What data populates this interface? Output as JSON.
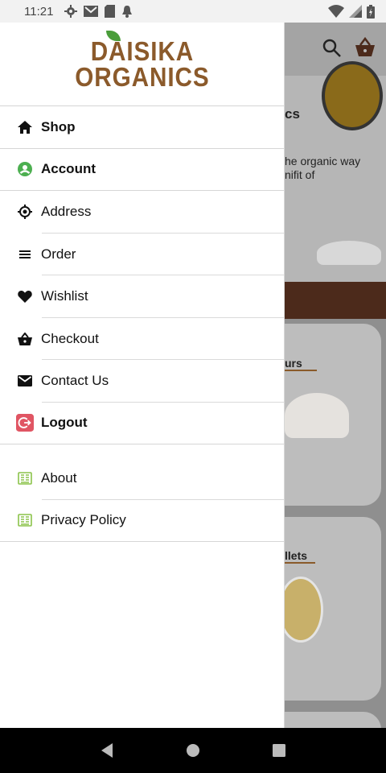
{
  "status_bar": {
    "time": "11:21"
  },
  "brand": {
    "logo_line1": "DAISIKA",
    "logo_line2": "ORGANICS"
  },
  "menu": {
    "primary": [
      {
        "label": "Shop",
        "icon": "home-icon",
        "bold": true
      },
      {
        "label": "Account",
        "icon": "account-icon",
        "bold": true
      },
      {
        "label": "Address",
        "icon": "location-icon",
        "bold": false
      },
      {
        "label": "Order",
        "icon": "list-icon",
        "bold": false
      },
      {
        "label": "Wishlist",
        "icon": "heart-icon",
        "bold": false
      },
      {
        "label": "Checkout",
        "icon": "basket-icon",
        "bold": false
      },
      {
        "label": "Contact Us",
        "icon": "mail-icon",
        "bold": false
      },
      {
        "label": "Logout",
        "icon": "logout-icon",
        "bold": true
      }
    ],
    "secondary": [
      {
        "label": "About",
        "icon": "document-icon"
      },
      {
        "label": "Privacy Policy",
        "icon": "document-icon"
      }
    ]
  },
  "background": {
    "hero_title_fragment": "cs",
    "hero_line1": "he organic way",
    "hero_line2": "nifit of",
    "card1_title": "urs",
    "card2_title": "llets"
  },
  "colors": {
    "brand": "#8b5a2b",
    "account_green": "#4caf50",
    "logout_red": "#e05563",
    "doc_green": "#8bc34a"
  }
}
